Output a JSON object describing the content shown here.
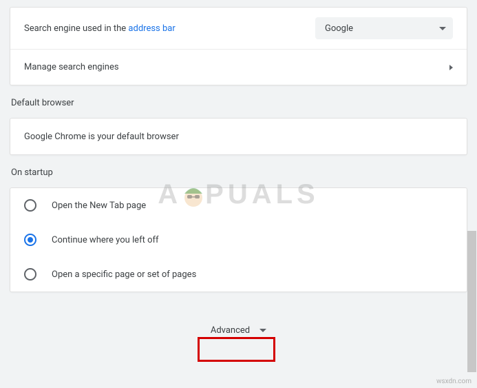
{
  "search_engine": {
    "label_prefix": "Search engine used in the ",
    "label_link": "address bar",
    "selected": "Google",
    "manage_label": "Manage search engines"
  },
  "default_browser": {
    "heading": "Default browser",
    "status": "Google Chrome is your default browser"
  },
  "on_startup": {
    "heading": "On startup",
    "options": [
      {
        "label": "Open the New Tab page",
        "selected": false
      },
      {
        "label": "Continue where you left off",
        "selected": true
      },
      {
        "label": "Open a specific page or set of pages",
        "selected": false
      }
    ]
  },
  "advanced_label": "Advanced",
  "watermark_text_left": "A",
  "watermark_text_right": "PUALS",
  "credit": "wsxdn.com"
}
